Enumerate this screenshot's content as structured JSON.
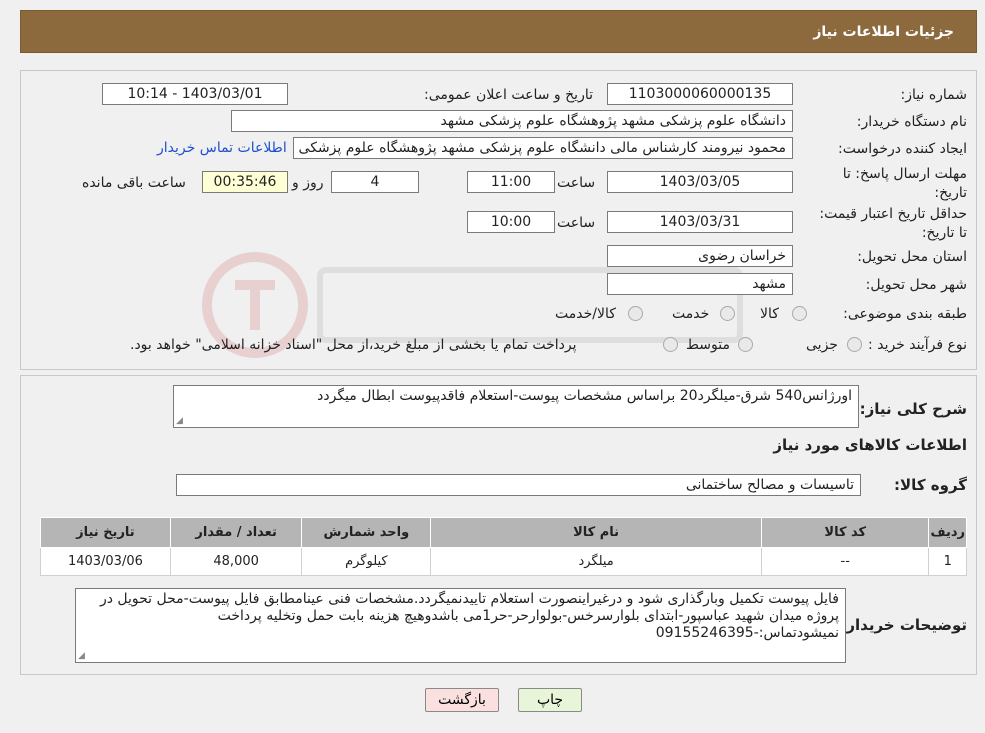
{
  "header": {
    "title": "جزئیات اطلاعات نیاز"
  },
  "form": {
    "need_number": {
      "label": "شماره نیاز:",
      "value": "1103000060000135"
    },
    "announce_datetime": {
      "label": "تاریخ و ساعت اعلان عمومی:",
      "value": "1403/03/01 - 10:14"
    },
    "buyer_org": {
      "label": "نام دستگاه خریدار:",
      "value": "دانشگاه علوم پزشکی مشهد   پژوهشگاه علوم پزشکی مشهد"
    },
    "requester": {
      "label": "ایجاد کننده درخواست:",
      "value": "محمود نیرومند کارشناس مالی دانشگاه علوم پزشکی مشهد   پژوهشگاه علوم پزشکی مشهد",
      "contact_link": "اطلاعات تماس خریدار"
    },
    "response_deadline": {
      "label": "مهلت ارسال پاسخ: تا تاریخ:",
      "date": "1403/03/05",
      "time_label": "ساعت",
      "time": "11:00",
      "days": "4",
      "days_label": "روز و",
      "remaining": "00:35:46",
      "remaining_label": "ساعت باقی مانده"
    },
    "price_validity": {
      "label": "حداقل تاریخ اعتبار قیمت: تا تاریخ:",
      "date": "1403/03/31",
      "time_label": "ساعت",
      "time": "10:00"
    },
    "province": {
      "label": "استان محل تحویل:",
      "value": "خراسان رضوی"
    },
    "city": {
      "label": "شهر محل تحویل:",
      "value": "مشهد"
    },
    "category": {
      "label": "طبقه بندی موضوعی:",
      "options": [
        "کالا",
        "خدمت",
        "کالا/خدمت"
      ]
    },
    "purchase_type": {
      "label": "نوع فرآیند خرید :",
      "options": [
        "جزیی",
        "متوسط"
      ],
      "note": "پرداخت تمام یا بخشی از مبلغ خرید،از محل \"اسناد خزانه اسلامی\" خواهد بود."
    }
  },
  "summary": {
    "label": "شرح کلی نیاز:",
    "value": "اورژانس540 شرق-میلگرد20 براساس مشخصات پیوست-استعلام فاقدپیوست ابطال میگردد"
  },
  "goods_section": {
    "title": "اطلاعات کالاهای مورد نیاز",
    "group_label": "گروه کالا:",
    "group_value": "تاسیسات و مصالح ساختمانی"
  },
  "table": {
    "headers": [
      "ردیف",
      "کد کالا",
      "نام کالا",
      "واحد شمارش",
      "تعداد / مقدار",
      "تاریخ نیاز"
    ],
    "rows": [
      [
        "1",
        "--",
        "میلگرد",
        "کیلوگرم",
        "48,000",
        "1403/03/06"
      ]
    ]
  },
  "buyer_notes": {
    "label": "توضیحات خریدار:",
    "value": "فایل پیوست تکمیل وبارگذاری شود و درغیراینصورت استعلام تاییدنمیگردد.مشخصات فنی عینامطابق فایل پیوست-محل تحویل در پروژه میدان شهید عباسپور-ابتدای بلوارسرخس-بولوارحر-حر1می باشدوهیچ هزینه بابت حمل وتخلیه پرداخت نمیشودتماس:-09155246395"
  },
  "buttons": {
    "print": "چاپ",
    "back": "بازگشت"
  },
  "colors": {
    "header_bg": "#8d6a3d",
    "table_header_bg": "#b5b5b5",
    "link": "#1f4fd1"
  }
}
